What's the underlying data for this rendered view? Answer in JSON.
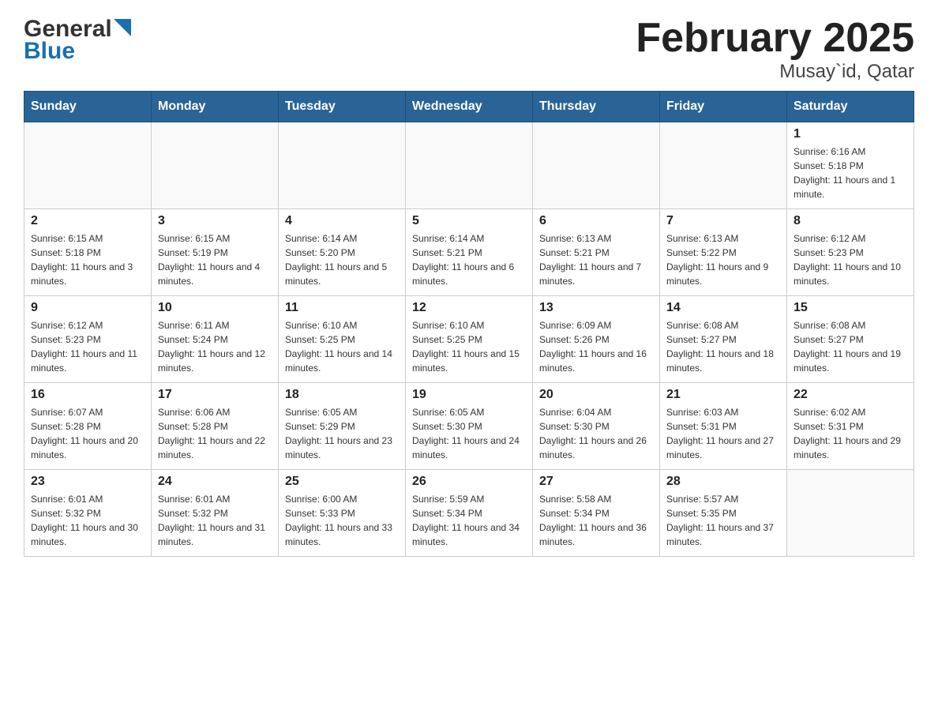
{
  "header": {
    "title": "February 2025",
    "subtitle": "Musay`id, Qatar",
    "logo_general": "General",
    "logo_blue": "Blue"
  },
  "days_of_week": [
    "Sunday",
    "Monday",
    "Tuesday",
    "Wednesday",
    "Thursday",
    "Friday",
    "Saturday"
  ],
  "weeks": [
    [
      {
        "day": "",
        "info": ""
      },
      {
        "day": "",
        "info": ""
      },
      {
        "day": "",
        "info": ""
      },
      {
        "day": "",
        "info": ""
      },
      {
        "day": "",
        "info": ""
      },
      {
        "day": "",
        "info": ""
      },
      {
        "day": "1",
        "info": "Sunrise: 6:16 AM\nSunset: 5:18 PM\nDaylight: 11 hours and 1 minute."
      }
    ],
    [
      {
        "day": "2",
        "info": "Sunrise: 6:15 AM\nSunset: 5:18 PM\nDaylight: 11 hours and 3 minutes."
      },
      {
        "day": "3",
        "info": "Sunrise: 6:15 AM\nSunset: 5:19 PM\nDaylight: 11 hours and 4 minutes."
      },
      {
        "day": "4",
        "info": "Sunrise: 6:14 AM\nSunset: 5:20 PM\nDaylight: 11 hours and 5 minutes."
      },
      {
        "day": "5",
        "info": "Sunrise: 6:14 AM\nSunset: 5:21 PM\nDaylight: 11 hours and 6 minutes."
      },
      {
        "day": "6",
        "info": "Sunrise: 6:13 AM\nSunset: 5:21 PM\nDaylight: 11 hours and 7 minutes."
      },
      {
        "day": "7",
        "info": "Sunrise: 6:13 AM\nSunset: 5:22 PM\nDaylight: 11 hours and 9 minutes."
      },
      {
        "day": "8",
        "info": "Sunrise: 6:12 AM\nSunset: 5:23 PM\nDaylight: 11 hours and 10 minutes."
      }
    ],
    [
      {
        "day": "9",
        "info": "Sunrise: 6:12 AM\nSunset: 5:23 PM\nDaylight: 11 hours and 11 minutes."
      },
      {
        "day": "10",
        "info": "Sunrise: 6:11 AM\nSunset: 5:24 PM\nDaylight: 11 hours and 12 minutes."
      },
      {
        "day": "11",
        "info": "Sunrise: 6:10 AM\nSunset: 5:25 PM\nDaylight: 11 hours and 14 minutes."
      },
      {
        "day": "12",
        "info": "Sunrise: 6:10 AM\nSunset: 5:25 PM\nDaylight: 11 hours and 15 minutes."
      },
      {
        "day": "13",
        "info": "Sunrise: 6:09 AM\nSunset: 5:26 PM\nDaylight: 11 hours and 16 minutes."
      },
      {
        "day": "14",
        "info": "Sunrise: 6:08 AM\nSunset: 5:27 PM\nDaylight: 11 hours and 18 minutes."
      },
      {
        "day": "15",
        "info": "Sunrise: 6:08 AM\nSunset: 5:27 PM\nDaylight: 11 hours and 19 minutes."
      }
    ],
    [
      {
        "day": "16",
        "info": "Sunrise: 6:07 AM\nSunset: 5:28 PM\nDaylight: 11 hours and 20 minutes."
      },
      {
        "day": "17",
        "info": "Sunrise: 6:06 AM\nSunset: 5:28 PM\nDaylight: 11 hours and 22 minutes."
      },
      {
        "day": "18",
        "info": "Sunrise: 6:05 AM\nSunset: 5:29 PM\nDaylight: 11 hours and 23 minutes."
      },
      {
        "day": "19",
        "info": "Sunrise: 6:05 AM\nSunset: 5:30 PM\nDaylight: 11 hours and 24 minutes."
      },
      {
        "day": "20",
        "info": "Sunrise: 6:04 AM\nSunset: 5:30 PM\nDaylight: 11 hours and 26 minutes."
      },
      {
        "day": "21",
        "info": "Sunrise: 6:03 AM\nSunset: 5:31 PM\nDaylight: 11 hours and 27 minutes."
      },
      {
        "day": "22",
        "info": "Sunrise: 6:02 AM\nSunset: 5:31 PM\nDaylight: 11 hours and 29 minutes."
      }
    ],
    [
      {
        "day": "23",
        "info": "Sunrise: 6:01 AM\nSunset: 5:32 PM\nDaylight: 11 hours and 30 minutes."
      },
      {
        "day": "24",
        "info": "Sunrise: 6:01 AM\nSunset: 5:32 PM\nDaylight: 11 hours and 31 minutes."
      },
      {
        "day": "25",
        "info": "Sunrise: 6:00 AM\nSunset: 5:33 PM\nDaylight: 11 hours and 33 minutes."
      },
      {
        "day": "26",
        "info": "Sunrise: 5:59 AM\nSunset: 5:34 PM\nDaylight: 11 hours and 34 minutes."
      },
      {
        "day": "27",
        "info": "Sunrise: 5:58 AM\nSunset: 5:34 PM\nDaylight: 11 hours and 36 minutes."
      },
      {
        "day": "28",
        "info": "Sunrise: 5:57 AM\nSunset: 5:35 PM\nDaylight: 11 hours and 37 minutes."
      },
      {
        "day": "",
        "info": ""
      }
    ]
  ]
}
